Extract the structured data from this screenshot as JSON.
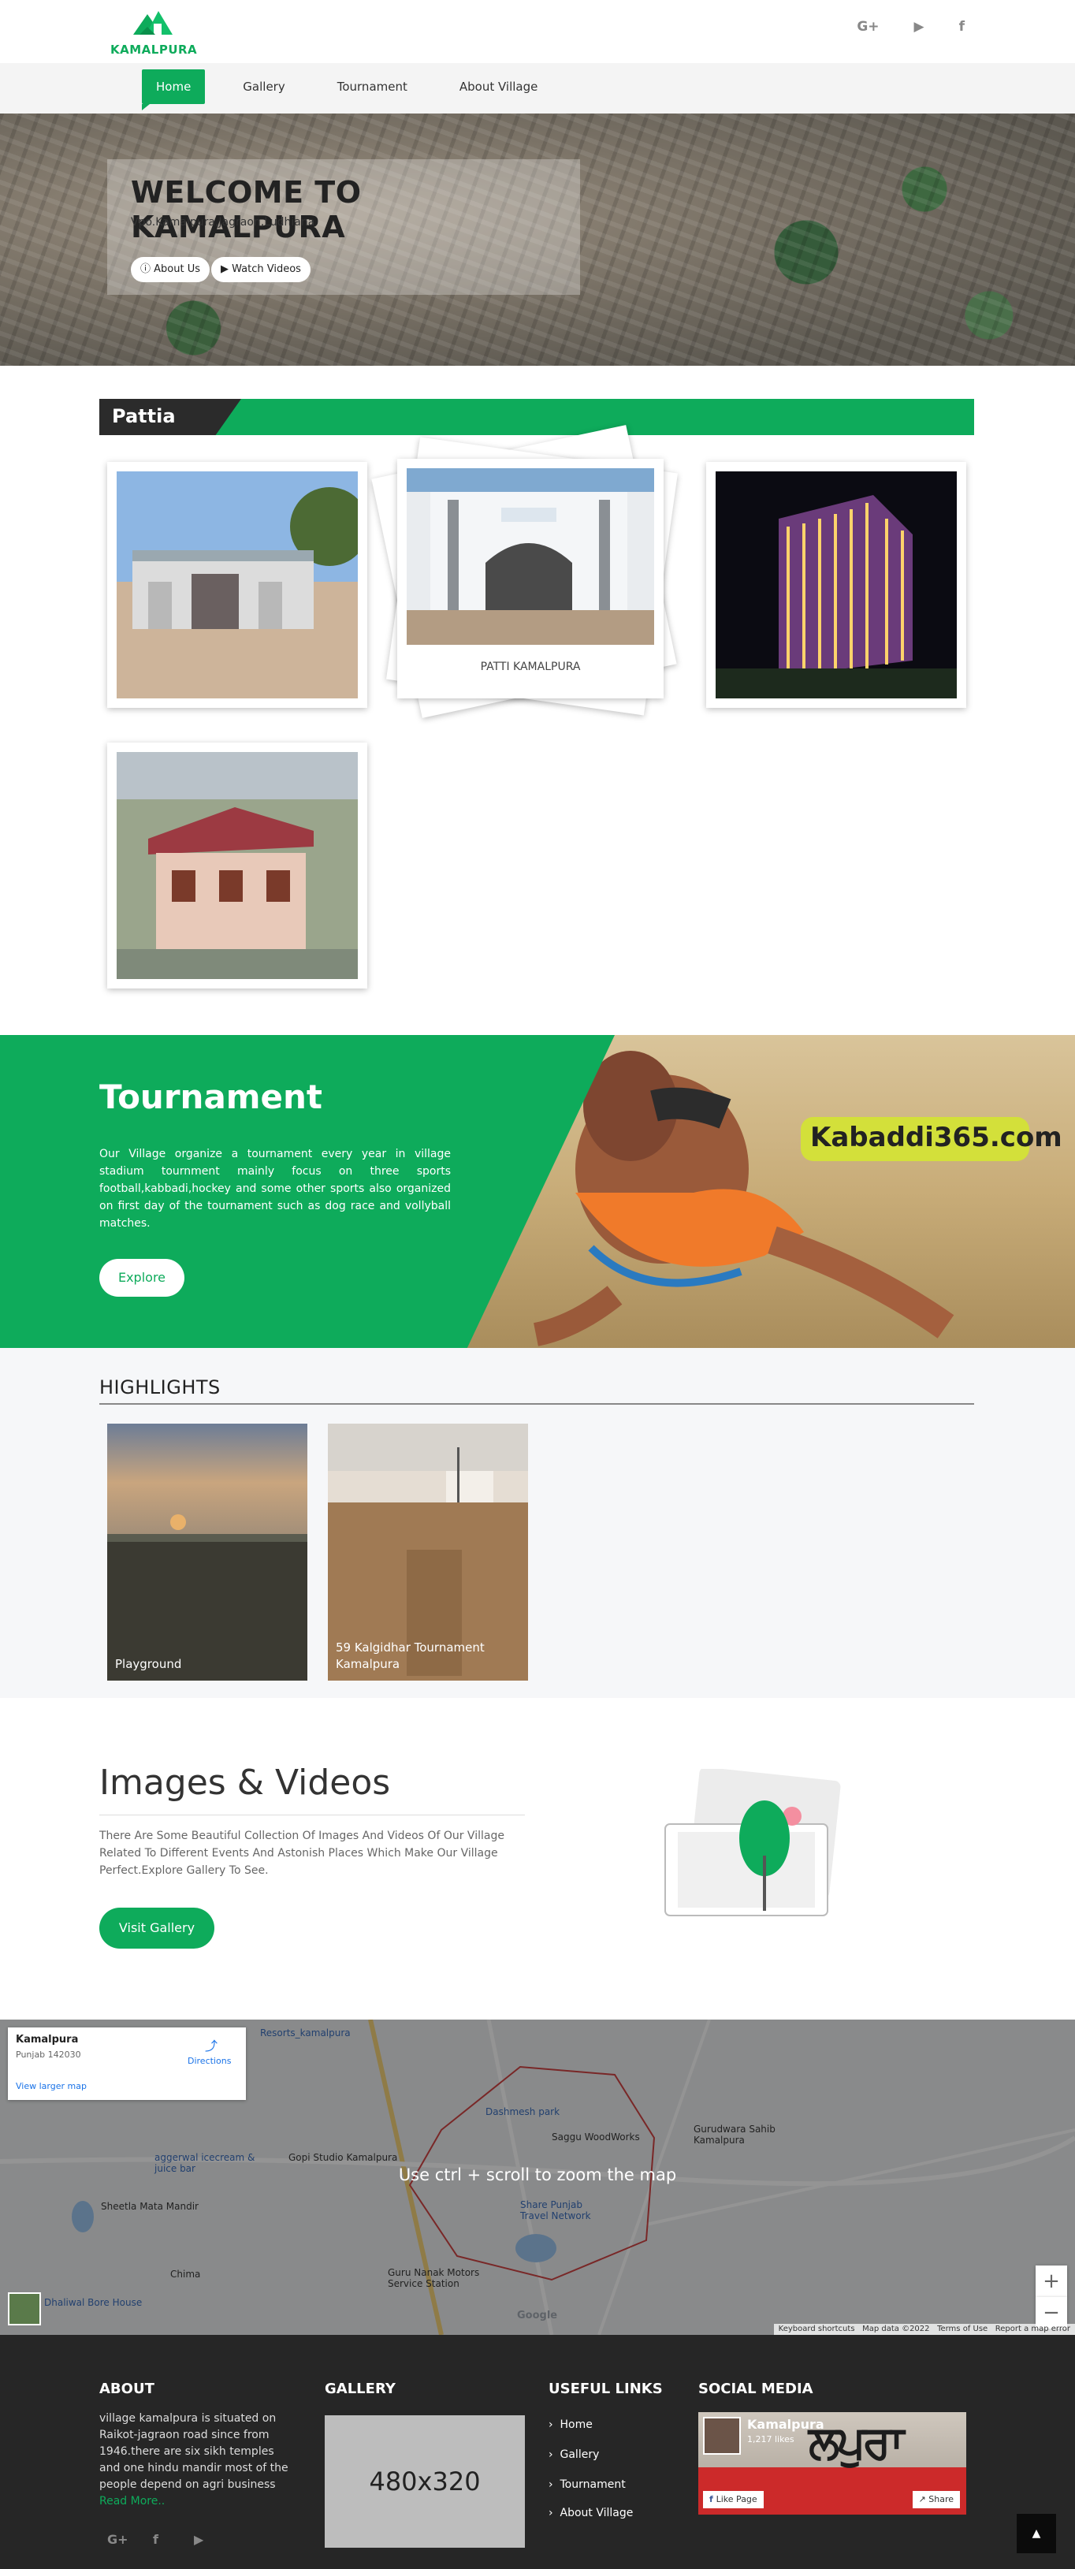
{
  "header": {
    "logo_text": "KAMALPURA",
    "social": [
      "G+",
      "▶",
      "f"
    ]
  },
  "nav": {
    "items": [
      "Home",
      "Gallery",
      "Tournament",
      "About Village"
    ],
    "active": "Home"
  },
  "hero": {
    "title": "WELCOME TO KAMALPURA",
    "subtitle": "Vpo.Kamalpura,Jagraon,Ludhiana",
    "about_btn": "About Us",
    "videos_btn": "Watch Videos"
  },
  "pattia": {
    "title": "Pattia",
    "featured_caption": "PATTI KAMALPURA"
  },
  "tournament": {
    "title": "Tournament",
    "text": "Our Village organize a tournament every year in village stadium tournment mainly focus on three sports football,kabbadi,hockey and some other sports also organized on first day of the tournament such as dog race and vollyball matches.",
    "button": "Explore",
    "image_brand": "Kabaddi365.com"
  },
  "highlights": {
    "title": "HIGHLIGHTS",
    "cards": [
      {
        "caption": "Playground"
      },
      {
        "caption": "59 Kalgidhar Tournament Kamalpura"
      }
    ]
  },
  "images_videos": {
    "title": "Images & Videos",
    "text": "There Are Some Beautiful Collection Of Images And Videos Of Our Village Related To Different Events And Astonish Places Which Make Our Village Perfect.Explore Gallery To See.",
    "button": "Visit Gallery"
  },
  "map": {
    "place_name": "Kamalpura",
    "place_address": "Punjab 142030",
    "directions": "Directions",
    "larger_map": "View larger map",
    "zoom_message": "Use ctrl + scroll to zoom the map",
    "labels": [
      "Resorts_kamalpura",
      "Dashmesh park",
      "Saggu WoodWorks",
      "Gurudwara Sahib Kamalpura",
      "Gopi Studio Kamalpura",
      "aggerwal icecream & juice bar",
      "Sheetla Mata Mandir",
      "Share Punjab Travel Network",
      "Guru Nanak Motors Service Station",
      "Dhaliwal Bore House",
      "Chima"
    ],
    "zoom_in": "+",
    "zoom_out": "−",
    "footer_items": [
      "Keyboard shortcuts",
      "Map data ©2022",
      "Terms of Use",
      "Report a map error"
    ],
    "google": "Google"
  },
  "footer": {
    "about_title": "ABOUT",
    "about_text": "village kamalpura is situated on Raikot-jagraon road since from 1946.there are six sikh temples and one hindu mandir most of the people depend on agri business",
    "read_more": "Read More..",
    "gallery_title": "GALLERY",
    "gallery_placeholder": "480x320",
    "links_title": "USEFUL LINKS",
    "links": [
      "Home",
      "Gallery",
      "Tournament",
      "About Village"
    ],
    "social_title": "SOCIAL MEDIA",
    "fb_name": "Kamalpura",
    "fb_likes": "1,217 likes",
    "fb_like_btn": "Like Page",
    "fb_share_btn": "Share",
    "social": [
      "G+",
      "f",
      "▶"
    ]
  },
  "colors": {
    "brand_green": "#0eab5b",
    "dark": "#262626"
  }
}
